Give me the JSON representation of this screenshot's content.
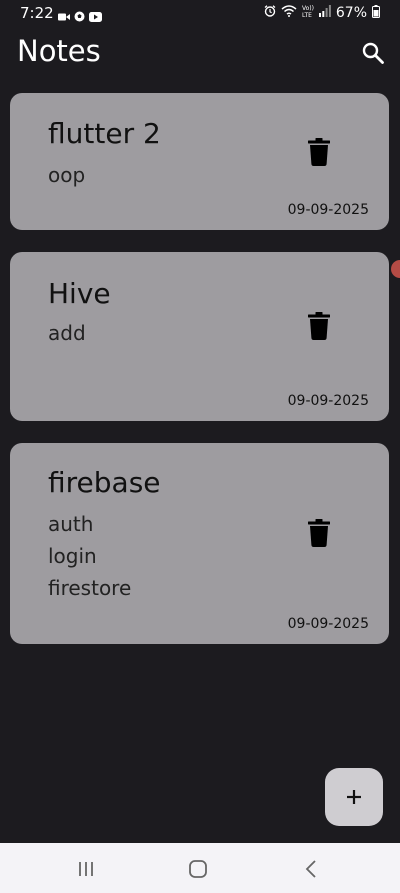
{
  "status_bar": {
    "time": "7:22",
    "battery": "67%",
    "left_icons": [
      "video-camera-icon",
      "soccer-ball-icon",
      "youtube-icon"
    ],
    "right_icons": [
      "alarm-icon",
      "wifi-icon",
      "volte-icon",
      "signal-icon",
      "battery-icon"
    ]
  },
  "app_bar": {
    "title": "Notes",
    "search_icon": "search-icon"
  },
  "notes": [
    {
      "title": "flutter 2",
      "body": "oop",
      "date": "09-09-2025"
    },
    {
      "title": "Hive",
      "body": "add",
      "date": "09-09-2025"
    },
    {
      "title": "firebase",
      "body": "auth\nlogin\nfirestore",
      "date": "09-09-2025"
    }
  ],
  "fab": {
    "icon": "plus-icon"
  },
  "nav_bar": {
    "buttons": [
      "recents-icon",
      "home-icon",
      "back-icon"
    ]
  },
  "colors": {
    "background": "#1c1b1f",
    "card": "#9e9ca0",
    "fab": "#cfcdd1",
    "nav_bar": "#f4f3f7"
  }
}
